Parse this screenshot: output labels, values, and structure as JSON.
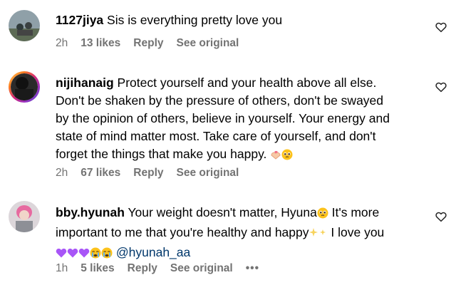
{
  "comments": [
    {
      "username": "1127jiya",
      "text": " Sis is everything pretty love you",
      "time": "2h",
      "likes": "13 likes",
      "reply": "Reply",
      "see_original": "See original"
    },
    {
      "username": "nijihanaig",
      "text_lines": [
        " Protect yourself and your health above all else.",
        "Don't be shaken by the pressure of others, don't be swayed",
        "by the opinion of others, believe in yourself. Your energy and",
        "state of mind matter most. Take care of yourself, and don't",
        "forget the things that make you happy. "
      ],
      "emoji_end": [
        "hands-heart-icon",
        "pleading-face-icon"
      ],
      "time": "2h",
      "likes": "67 likes",
      "reply": "Reply",
      "see_original": "See original"
    },
    {
      "username": "bby.hyunah",
      "line1": " Your weight doesn't matter, Hyuna",
      "line1_after": " It's more",
      "line2": "important to me that you're healthy and happy",
      "line2_after": " I love you",
      "mention": "@hyunah_aa",
      "emoji_line3": [
        "purple-heart-icon",
        "purple-heart-icon",
        "purple-heart-icon",
        "crying-face-icon",
        "crying-face-icon"
      ],
      "time": "1h",
      "likes": "5 likes",
      "reply": "Reply",
      "see_original": "See original",
      "more": "•••"
    }
  ],
  "colors": {
    "meta_gray": "#737373",
    "mention_blue": "#00376b",
    "purple_heart": "#a855f7"
  }
}
